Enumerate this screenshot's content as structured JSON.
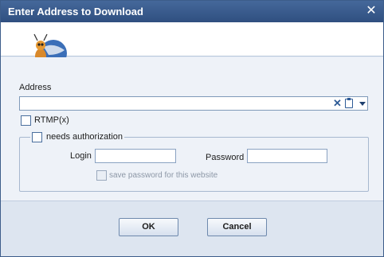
{
  "window": {
    "title": "Enter Address to Download",
    "close_icon": "close-icon"
  },
  "form": {
    "address_label": "Address",
    "address_value": "",
    "rtmp_label": "RTMP(x)",
    "auth_label": "needs authorization",
    "login_label": "Login",
    "login_value": "",
    "password_label": "Password",
    "password_value": "",
    "save_password_label": "save password for this website"
  },
  "buttons": {
    "ok_label": "OK",
    "cancel_label": "Cancel"
  },
  "colors": {
    "titlebar": "#2f4f80",
    "background": "#e4ebf5"
  }
}
